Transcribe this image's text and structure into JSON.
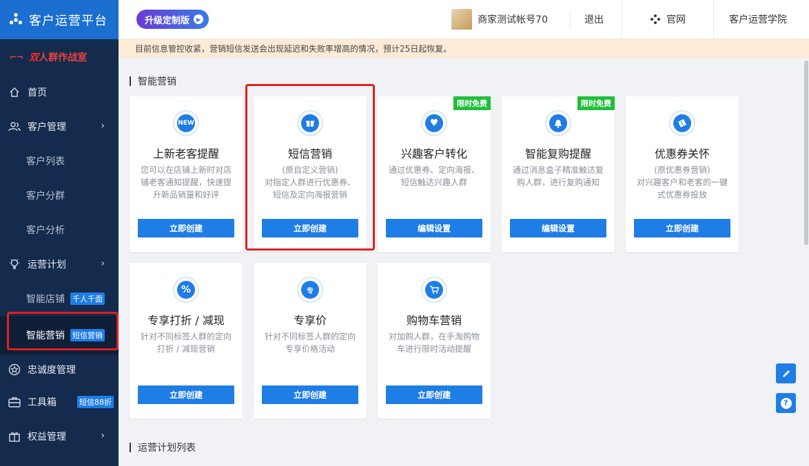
{
  "app": {
    "title": "客户运营平台"
  },
  "promo": {
    "text1": "双",
    "text2": "人群作战室"
  },
  "sidebar": {
    "items": [
      {
        "label": "首页"
      },
      {
        "label": "客户管理"
      },
      {
        "label": "客户列表"
      },
      {
        "label": "客户分群"
      },
      {
        "label": "客户分析"
      },
      {
        "label": "运营计划"
      },
      {
        "label": "智能店铺",
        "badge": "千人千面"
      },
      {
        "label": "智能营销",
        "badge": "短信营销"
      },
      {
        "label": "忠诚度管理"
      },
      {
        "label": "工具箱",
        "badge": "短信88折"
      },
      {
        "label": "权益管理"
      }
    ]
  },
  "topbar": {
    "upgrade_label": "升级定制版",
    "account": "商家测试帐号70",
    "logout": "退出",
    "official_site": "官网",
    "academy": "客户运营学院"
  },
  "notice": {
    "text": "目前信息管控收紧，营销短信发送会出现延迟和失败率增高的情况，预计25日起恢复。"
  },
  "main": {
    "section1_title": "智能营销",
    "section2_title": "运营计划列表",
    "cards": [
      {
        "icon_text": "NEW",
        "title": "上新老客提醒",
        "desc": "您可以在店铺上新时对店铺老客通知提醒，快速提升新品销量和好评",
        "button": "立即创建"
      },
      {
        "icon_text": "▣",
        "title": "短信营销",
        "desc": "(原自定义营销)\n对指定人群进行优惠券、短信及定向海报营销",
        "button": "立即创建"
      },
      {
        "icon_text": "♥",
        "title": "兴趣客户转化",
        "desc": "通过优惠券、定向海报、短信触达兴趣人群",
        "button": "编辑设置",
        "tag": "限时免费"
      },
      {
        "icon_text": "🔔",
        "title": "智能复购提醒",
        "desc": "通过消息盒子精准触达复购人群，进行复购通知",
        "button": "编辑设置",
        "tag": "限时免费"
      },
      {
        "icon_text": "🎫",
        "title": "优惠券关怀",
        "desc": "(原优惠券营销)\n对兴趣客户和老客的一键式优惠券投放",
        "button": "立即创建"
      },
      {
        "icon_text": "%",
        "title": "专享打折 / 减现",
        "desc": "针对不同标签人群的定向打折 / 减现营销",
        "button": "立即创建"
      },
      {
        "icon_text": "专",
        "title": "专享价",
        "desc": "针对不同标签人群的定向专享价格活动",
        "button": "立即创建"
      },
      {
        "icon_text": "🛒",
        "title": "购物车营销",
        "desc": "对加购人群，在手淘购物车进行限时活动提醒",
        "button": "立即创建"
      }
    ]
  },
  "colors": {
    "sidebar_bg": "#142b4d",
    "accent": "#1f7de6",
    "logo_bg": "#1a6fd0",
    "tag_green": "#1fbf3a",
    "notice_bg": "#fdebd6",
    "highlight": "#e02020"
  }
}
